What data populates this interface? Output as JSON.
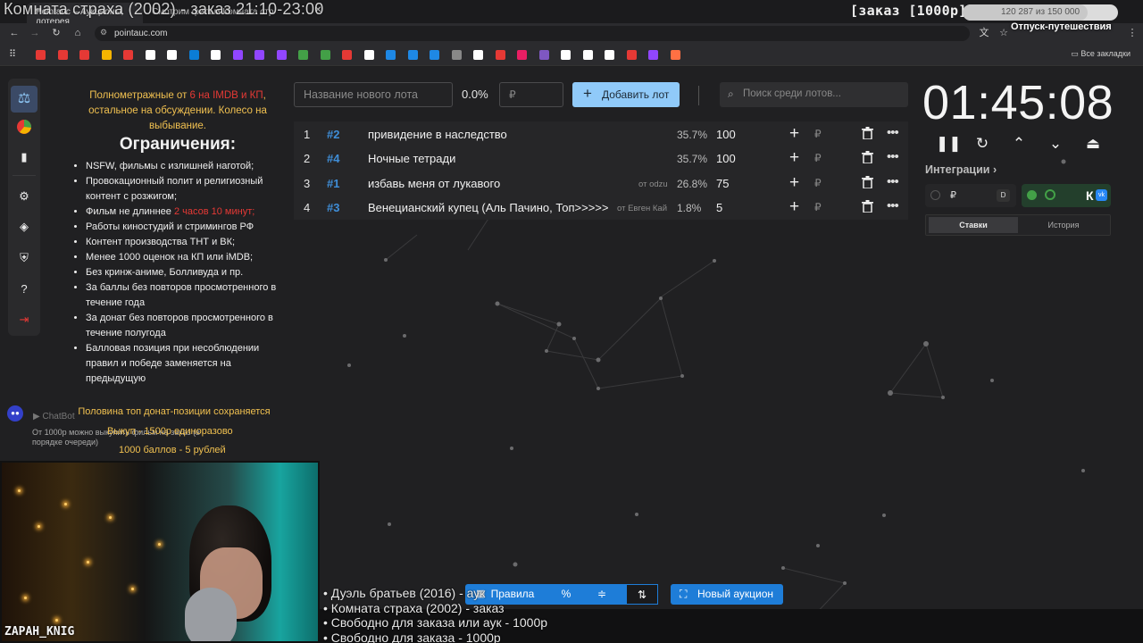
{
  "browser": {
    "tabs": [
      "Pointauc – Аукционы, лотерея",
      "Смотрим фильм Комната стр"
    ],
    "close_glyph": "✕",
    "url": "pointauc.com",
    "all_bookmarks": "Все закладки",
    "bookmarks": [
      {
        "icon": "bookmark-icon",
        "color": "#e53935"
      },
      {
        "icon": "bookmark-icon",
        "color": "#e53935"
      },
      {
        "icon": "bookmark-icon",
        "color": "#e53935"
      },
      {
        "icon": "bookmark-icon",
        "color": "#f4b400"
      },
      {
        "icon": "bookmark-icon",
        "color": "#e53935"
      },
      {
        "icon": "bookmark-icon",
        "color": "#ffffff"
      },
      {
        "icon": "bookmark-icon",
        "color": "#ffffff"
      },
      {
        "icon": "bookmark-icon",
        "color": "#0b7dd6"
      },
      {
        "icon": "bookmark-icon",
        "color": "#ffffff"
      },
      {
        "icon": "bookmark-icon",
        "color": "#9146ff"
      },
      {
        "icon": "bookmark-icon",
        "color": "#9146ff"
      },
      {
        "icon": "bookmark-icon",
        "color": "#9146ff"
      },
      {
        "icon": "bookmark-icon",
        "color": "#43a047"
      },
      {
        "icon": "bookmark-icon",
        "color": "#43a047"
      },
      {
        "icon": "bookmark-icon",
        "color": "#e53935"
      },
      {
        "icon": "bookmark-icon",
        "color": "#ffffff"
      },
      {
        "icon": "bookmark-icon",
        "color": "#1e88e5"
      },
      {
        "icon": "bookmark-icon",
        "color": "#1e88e5"
      },
      {
        "icon": "bookmark-icon",
        "color": "#1e88e5"
      },
      {
        "icon": "bookmark-icon",
        "color": "#888888"
      },
      {
        "icon": "bookmark-icon",
        "color": "#ffffff"
      },
      {
        "icon": "bookmark-icon",
        "color": "#e53935"
      },
      {
        "icon": "bookmark-icon",
        "color": "#e91e63"
      },
      {
        "icon": "bookmark-icon",
        "color": "#7e57c2"
      },
      {
        "icon": "bookmark-icon",
        "color": "#ffffff"
      },
      {
        "icon": "bookmark-icon",
        "color": "#ffffff"
      },
      {
        "icon": "bookmark-icon",
        "color": "#ffffff"
      },
      {
        "icon": "bookmark-icon",
        "color": "#e53935"
      },
      {
        "icon": "bookmark-icon",
        "color": "#9146ff"
      },
      {
        "icon": "bookmark-icon",
        "color": "#ff7043"
      }
    ]
  },
  "overlay": {
    "stream_title": "Комната страха (2002) - заказ 21:10-23:00",
    "order_badge": "[заказ [1000р]",
    "goal_current": "120 287",
    "goal_sep": "из",
    "goal_total": "150 000",
    "goal_fraction": 0.8019,
    "goal_next": "Отпуск-путешествия"
  },
  "rules": {
    "intro_1": "Полнометражные от ",
    "intro_red": "6 на IMDB и КП",
    "intro_2": ", остальное на обсуждении. Колесо на выбывание.",
    "heading": "Ограничения:",
    "items": [
      "NSFW, фильмы с излишней наготой;",
      "Провокационный полит и религиозный контент с розжигом;",
      "Фильм не длиннее ",
      "Работы киностудий и стримингов РФ",
      "Контент производства ТНТ и ВК;",
      "Менее 1000 оценок на КП или iMDB;",
      "Без кринж-аниме, Болливуда и пр.",
      "За баллы без повторов просмотренного в течение года",
      "За донат без повторов просмотренного в течение полугода",
      "Балловая позиция при несоблюдении правил и победе заменяется на предыдущую"
    ],
    "item3_red": "2 часов 10 минут;",
    "half": "Половина топ донат-позиции сохраняется",
    "once": "Выкуп - 1500р единоразово",
    "points": "1000 баллов - 5 рублей",
    "chatbot_name": "ChatBot",
    "chatbot_msg": "От 1000р можно выкупить фильм на заказ (в порядке очереди)"
  },
  "lots": {
    "name_placeholder": "Название нового лота",
    "new_pct": "0.0%",
    "rub_placeholder": "₽",
    "add_label": "Добавить лот",
    "search_placeholder": "Поиск среди лотов...",
    "items": [
      {
        "n": "1",
        "fast": "#2",
        "name": "привидение в наследство",
        "from": "",
        "pct": "35.7%",
        "amount": "100"
      },
      {
        "n": "2",
        "fast": "#4",
        "name": "Ночные тетради",
        "from": "",
        "pct": "35.7%",
        "amount": "100"
      },
      {
        "n": "3",
        "fast": "#1",
        "name": "избавь меня от лукавого",
        "from": "от odzu",
        "pct": "26.8%",
        "amount": "75"
      },
      {
        "n": "4",
        "fast": "#3",
        "name": "Венецианский купец (Аль Пачино, Топ>>>>>",
        "from": "от Евген Кай",
        "pct": "1.8%",
        "amount": "5"
      }
    ],
    "currency": "₽"
  },
  "timer": {
    "value": "01:45:08",
    "integrations": "Интеграции",
    "int1_currency": "₽",
    "int2_label": "К",
    "tabs": [
      "Ставки",
      "История"
    ]
  },
  "bottom": {
    "queue": [
      "• Дуэль братьев (2016) - аук",
      "• Комната страха (2002) - заказ",
      "• Свободно для заказа или аук - 1000р",
      "• Свободно для заказа - 1000р"
    ],
    "rules_btn": "Правила",
    "new_auction": "Новый аукцион"
  },
  "webcam": {
    "name": "ZAPAH_KNIG"
  }
}
